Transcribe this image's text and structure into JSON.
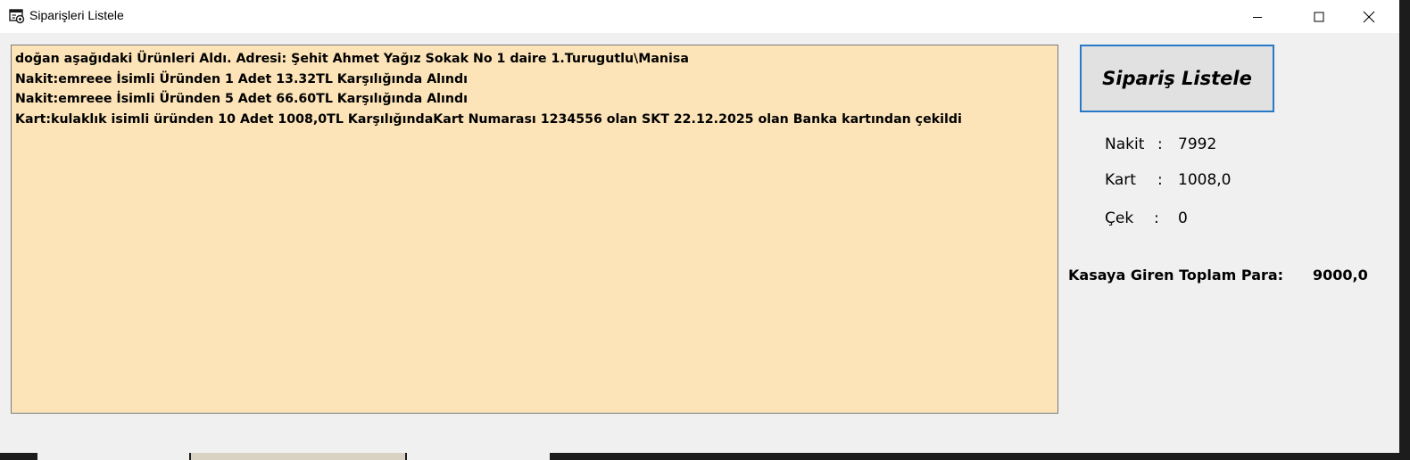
{
  "window": {
    "title": "Siparişleri Listele"
  },
  "orders": {
    "lines": [
      "doğan aşağıdaki Ürünleri Aldı. Adresi: Şehit Ahmet Yağız Sokak No 1 daire 1.Turugutlu\\Manisa",
      "Nakit:emreee İsimli Üründen 1 Adet 13.32TL Karşılığında Alındı",
      "Nakit:emreee İsimli Üründen 5 Adet 66.60TL Karşılığında Alındı",
      "Kart:kulaklık isimli üründen 10 Adet  1008,0TL KarşılığındaKart Numarası 1234556 olan SKT 22.12.2025 olan Banka kartından çekildi"
    ]
  },
  "actions": {
    "list_button_label": "Sipariş Listele"
  },
  "summary": {
    "cash_label": "Nakit",
    "cash_value": "7992",
    "card_label": "Kart",
    "card_value": "1008,0",
    "check_label": "Çek",
    "check_value": "0",
    "separator": ":",
    "total_label": "Kasaya Giren Toplam Para:",
    "total_value": "9000,0"
  }
}
